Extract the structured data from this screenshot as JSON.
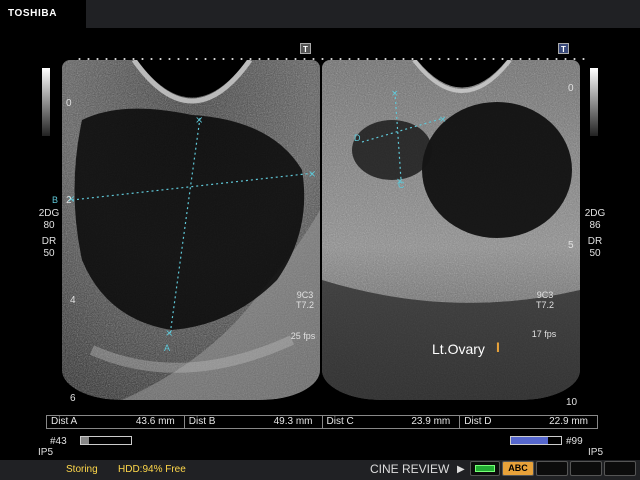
{
  "header": {
    "brand": "TOSHIBA"
  },
  "markers": {
    "left_t": "T",
    "right_t": "T"
  },
  "left_panel": {
    "params": [
      "2DG",
      "80",
      "DR",
      "50"
    ],
    "probe": [
      "9C3",
      "T7.2"
    ],
    "fps": "25 fps",
    "depth_marks": [
      "0",
      "2",
      "4",
      "6"
    ],
    "measure_letters": [
      "A",
      "B"
    ]
  },
  "right_panel": {
    "params": [
      "2DG",
      "86",
      "DR",
      "50"
    ],
    "probe": [
      "9C3",
      "T7.2"
    ],
    "fps": "17 fps",
    "depth_marks": [
      "0",
      "5",
      "10"
    ],
    "measure_letters": [
      "C",
      "D"
    ],
    "annotation": "Lt.Ovary",
    "annotation_cursor": "I"
  },
  "measurements": [
    {
      "name": "Dist  A",
      "value": "43.6 mm"
    },
    {
      "name": "Dist  B",
      "value": "49.3 mm"
    },
    {
      "name": "Dist  C",
      "value": "23.9 mm"
    },
    {
      "name": "Dist  D",
      "value": "22.9 mm"
    }
  ],
  "cine": {
    "left_frame": "#43",
    "left_progress": 0.15,
    "right_frame": "#99",
    "right_progress": 0.74,
    "left_ip": "IP5",
    "right_ip": "IP5"
  },
  "status": {
    "storing": "Storing",
    "hdd": "HDD:94% Free",
    "cine_review": "CINE REVIEW",
    "play_symbol": "▶",
    "abc": "ABC"
  },
  "colors": {
    "caliper": "#5fc8d8",
    "status_text": "#ffd84a",
    "accent": "#e8a23a"
  }
}
